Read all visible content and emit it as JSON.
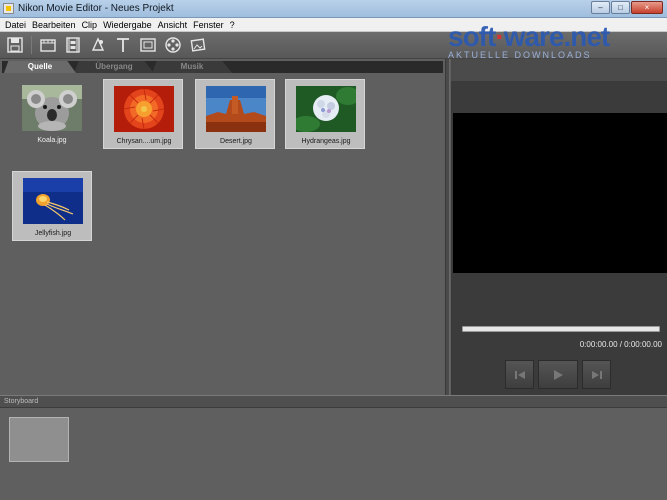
{
  "window": {
    "title": "Nikon Movie Editor - Neues Projekt",
    "buttons": {
      "minimize": "–",
      "maximize": "□",
      "close": "×"
    }
  },
  "menu": [
    "Datei",
    "Bearbeiten",
    "Clip",
    "Wiedergabe",
    "Ansicht",
    "Fenster",
    "?"
  ],
  "toolbar": {
    "icons": [
      "save-icon",
      "new-clip-icon",
      "filmstrip-icon",
      "effect-icon",
      "text-icon",
      "frame-icon",
      "reel-icon",
      "photo-icon"
    ]
  },
  "watermark": {
    "brand_a": "soft",
    "brand_dot": "·",
    "brand_b": "ware.net",
    "tagline": "AKTUELLE DOWNLOADS"
  },
  "tabs": {
    "source": "Quelle",
    "transition": "Übergang",
    "music": "Musik"
  },
  "media": [
    {
      "label": "Koala.jpg",
      "selected": false
    },
    {
      "label": "Chrysan....um.jpg",
      "selected": true
    },
    {
      "label": "Desert.jpg",
      "selected": true
    },
    {
      "label": "Hydrangeas.jpg",
      "selected": true
    },
    {
      "label": "Jellyfish.jpg",
      "selected": true
    }
  ],
  "preview": {
    "timecode": "0:00:00.00 / 0:00:00.00",
    "progress": 0
  },
  "storyboard": {
    "label": "Storyboard"
  }
}
